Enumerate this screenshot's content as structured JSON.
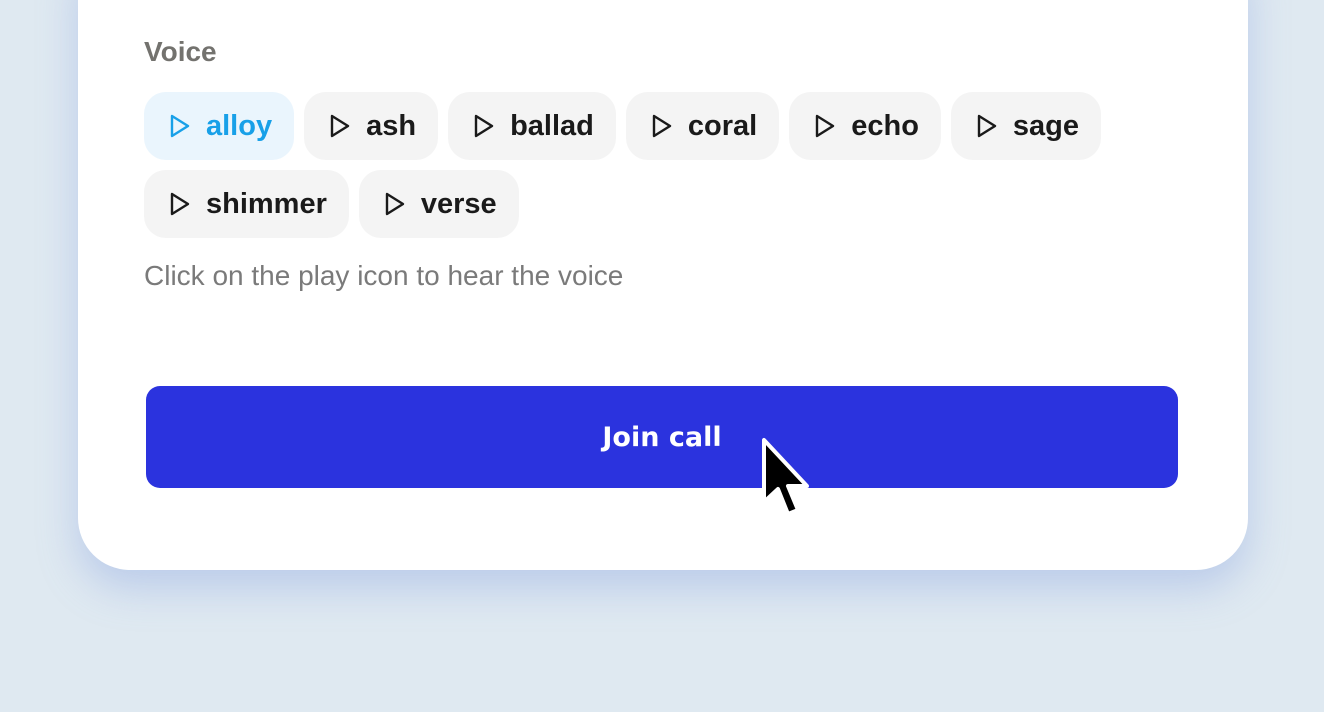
{
  "voice": {
    "label": "Voice",
    "selected": "alloy",
    "options": [
      {
        "label": "alloy",
        "icon": "play-icon"
      },
      {
        "label": "ash",
        "icon": "play-icon"
      },
      {
        "label": "ballad",
        "icon": "play-icon"
      },
      {
        "label": "coral",
        "icon": "play-icon"
      },
      {
        "label": "echo",
        "icon": "play-icon"
      },
      {
        "label": "sage",
        "icon": "play-icon"
      },
      {
        "label": "shimmer",
        "icon": "play-icon"
      },
      {
        "label": "verse",
        "icon": "play-icon"
      }
    ],
    "hint": "Click on the play icon to hear the voice"
  },
  "join_button": {
    "label": "Join call"
  },
  "colors": {
    "background": "#dfe9f1",
    "card": "#ffffff",
    "accent": "#2b33de",
    "selected_text": "#18a0e8",
    "selected_bg": "#eaf5fd",
    "chip_bg": "#f4f4f4"
  }
}
